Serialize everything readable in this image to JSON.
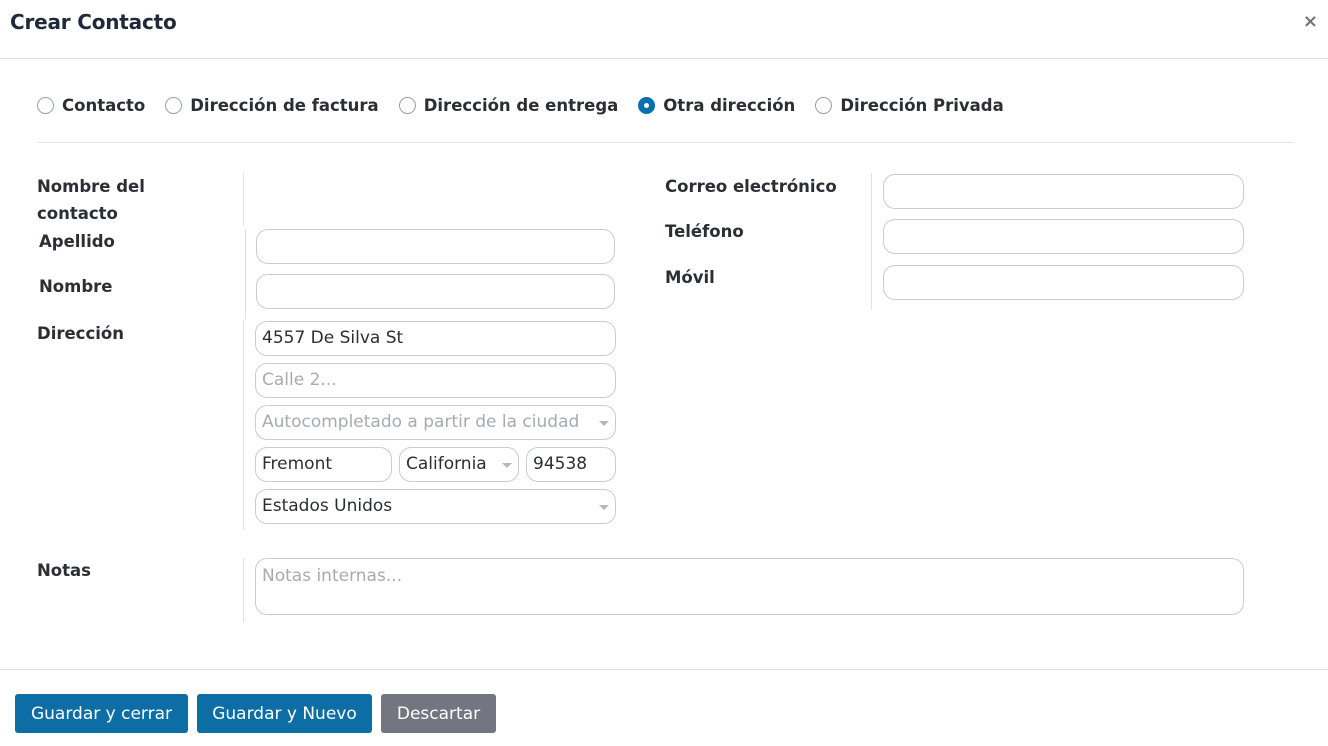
{
  "dialog": {
    "title": "Crear Contacto",
    "close_icon": "×"
  },
  "address_types": [
    {
      "label": "Contacto",
      "checked": false
    },
    {
      "label": "Dirección de factura",
      "checked": false
    },
    {
      "label": "Dirección de entrega",
      "checked": false
    },
    {
      "label": "Otra dirección",
      "checked": true
    },
    {
      "label": "Dirección Privada",
      "checked": false
    }
  ],
  "form": {
    "contact_name_label": "Nombre del contacto",
    "lastname_label": "Apellido",
    "lastname_value": "",
    "firstname_label": "Nombre",
    "firstname_value": "",
    "address_label": "Dirección",
    "street": "4557 De Silva St",
    "street2_placeholder": "Calle 2...",
    "city_autocomplete_placeholder": "Autocompletado a partir de la ciudad",
    "city": "Fremont",
    "state": "California",
    "zip": "94538",
    "country": "Estados Unidos",
    "email_label": "Correo electrónico",
    "email_value": "",
    "phone_label": "Teléfono",
    "phone_value": "",
    "mobile_label": "Móvil",
    "mobile_value": "",
    "notes_label": "Notas",
    "notes_placeholder": "Notas internas..."
  },
  "footer": {
    "save_close": "Guardar y cerrar",
    "save_new": "Guardar y Nuevo",
    "discard": "Descartar"
  },
  "colors": {
    "primary": "#0d6ea5",
    "secondary": "#737681",
    "radio_checked": "#0b6fb0"
  }
}
